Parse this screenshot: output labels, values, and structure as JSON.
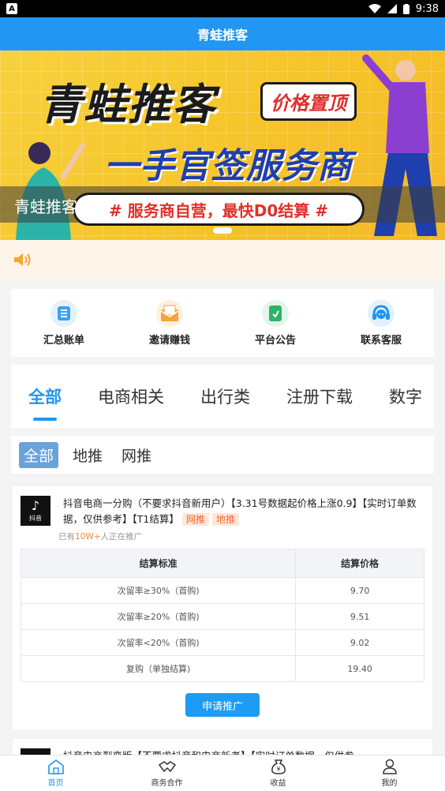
{
  "status_bar": {
    "time": "9:38",
    "left_badge": "A"
  },
  "app_bar": {
    "title": "青蛙推客"
  },
  "banner": {
    "headline": "青蛙推客",
    "tag": "价格置顶",
    "subheadline": "一手官签服务商",
    "slogan": "# 服务商自营，最快D0结算 #",
    "caption": "青蛙推客"
  },
  "notice": {
    "icon": "speaker-icon"
  },
  "quick_menu": [
    {
      "label": "汇总账单",
      "icon": "bill-icon",
      "color": "#3aa0f3"
    },
    {
      "label": "邀请赚钱",
      "icon": "envelope-icon",
      "color": "#f4a53a"
    },
    {
      "label": "平台公告",
      "icon": "announcement-icon",
      "color": "#2fb36a"
    },
    {
      "label": "联系客服",
      "icon": "headset-icon",
      "color": "#2196f3"
    }
  ],
  "category_tabs": [
    {
      "label": "全部",
      "active": true
    },
    {
      "label": "电商相关"
    },
    {
      "label": "出行类"
    },
    {
      "label": "注册下载"
    },
    {
      "label": "数字"
    }
  ],
  "sub_tabs": [
    {
      "label": "全部",
      "active": true
    },
    {
      "label": "地推"
    },
    {
      "label": "网推"
    }
  ],
  "products": [
    {
      "logo_text": "抖音",
      "title": "抖音电商一分购（不要求抖音新用户）【3.31号数据起价格上涨0.9】【实时订单数据，仅供参考】【T1结算】",
      "chips": [
        "网推",
        "地推"
      ],
      "promo_prefix": "已有",
      "promo_count": "10W+",
      "promo_suffix": "人正在推广",
      "table": {
        "headers": [
          "结算标准",
          "结算价格"
        ],
        "rows": [
          [
            "次留率≥30%（首购)",
            "9.70"
          ],
          [
            "次留率≥20%（首购)",
            "9.51"
          ],
          [
            "次留率<20%（首购)",
            "9.02"
          ],
          [
            "复购（单独结算)",
            "19.40"
          ]
        ]
      },
      "apply_label": "申请推广"
    },
    {
      "title": "抖音电商裂变版【不要求抖音和电商新老】【实时订单数据，仅供参"
    }
  ],
  "bottom_nav": [
    {
      "label": "首页",
      "icon": "home-icon",
      "active": true
    },
    {
      "label": "商务合作",
      "icon": "handshake-icon"
    },
    {
      "label": "收益",
      "icon": "money-bag-icon"
    },
    {
      "label": "我的",
      "icon": "user-icon"
    }
  ],
  "colors": {
    "primary": "#2196f3",
    "banner": "#f6c52b",
    "accent": "#f26b2b"
  }
}
